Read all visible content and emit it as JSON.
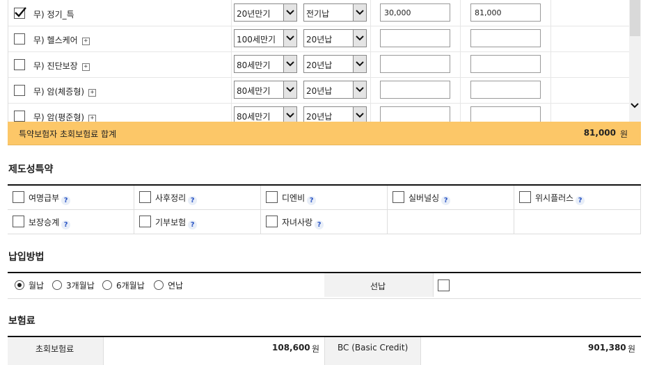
{
  "riders": [
    {
      "checked": true,
      "name": "무) 정기_특",
      "has_plus": false,
      "period": "20년만기",
      "pay": "전기납",
      "amount1": "30,000",
      "amount2": "81,000"
    },
    {
      "checked": false,
      "name": "무) 헬스케어",
      "has_plus": true,
      "period": "100세만기",
      "pay": "20년납",
      "amount1": "",
      "amount2": ""
    },
    {
      "checked": false,
      "name": "무) 진단보장",
      "has_plus": true,
      "period": "80세만기",
      "pay": "20년납",
      "amount1": "",
      "amount2": ""
    },
    {
      "checked": false,
      "name": "무) 암(체증형)",
      "has_plus": true,
      "period": "80세만기",
      "pay": "20년납",
      "amount1": "",
      "amount2": ""
    },
    {
      "checked": false,
      "name": "무) 암(평준형)",
      "has_plus": true,
      "period": "80세만기",
      "pay": "20년납",
      "amount1": "",
      "amount2": ""
    }
  ],
  "plus_glyph": "+",
  "rider_summary": {
    "label": "특약보험자 초회보험료 합계",
    "value": "81,000",
    "unit": "원"
  },
  "system_section": {
    "title": "제도성특약",
    "help_glyph": "?",
    "items": [
      [
        "여명급부",
        "사후정리",
        "디엔비",
        "실버널싱",
        "위시플러스"
      ],
      [
        "보장승계",
        "기부보험",
        "자녀사랑"
      ]
    ]
  },
  "payment_section": {
    "title": "납입방법",
    "options": [
      "월납",
      "3개월납",
      "6개월납",
      "연납"
    ],
    "selected": "월납",
    "prepay_label": "선납",
    "prepay_checked": false
  },
  "premium_section": {
    "title": "보험료",
    "first_label": "초회보험료",
    "first_value": "108,600",
    "unit": "원",
    "bc_label": "BC (Basic Credit)",
    "bc_value": "901,380"
  },
  "colors": {
    "summary_bar": "#fcc768",
    "help_icon": "#2a55c4"
  }
}
